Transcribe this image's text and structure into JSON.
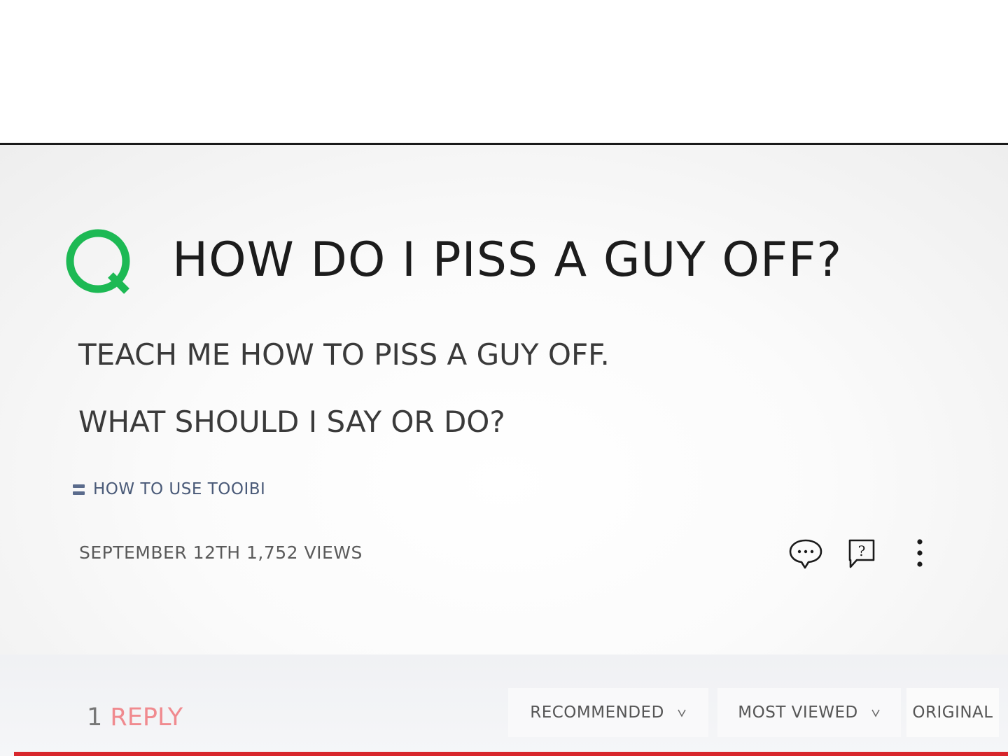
{
  "question": {
    "icon": "q-logo-icon",
    "title": "HOW DO I PISS A GUY OFF?",
    "body_line1": "TEACH ME HOW TO PISS A GUY OFF.",
    "body_line2": "WHAT SHOULD I SAY OR DO?",
    "accent_color": "#1db954"
  },
  "help_link": {
    "icon": "menu-lines-icon",
    "label": "HOW TO USE TOOIBI"
  },
  "meta": {
    "text": "SEPTEMBER 12TH 1,752 VIEWS"
  },
  "actions": {
    "comment_icon": "speech-bubble-icon",
    "question_icon": "question-bubble-icon",
    "question_glyph": "?",
    "more_icon": "vertical-dots-icon"
  },
  "replies": {
    "count": "1",
    "label": "REPLY",
    "label_color": "#f08a8f"
  },
  "sort_tabs": [
    {
      "label": "RECOMMENDED"
    },
    {
      "label": "MOST VIEWED"
    },
    {
      "label": "ORIGINAL"
    }
  ],
  "colors": {
    "bottom_bar": "#d8262c",
    "help_link": "#4a5a78"
  }
}
